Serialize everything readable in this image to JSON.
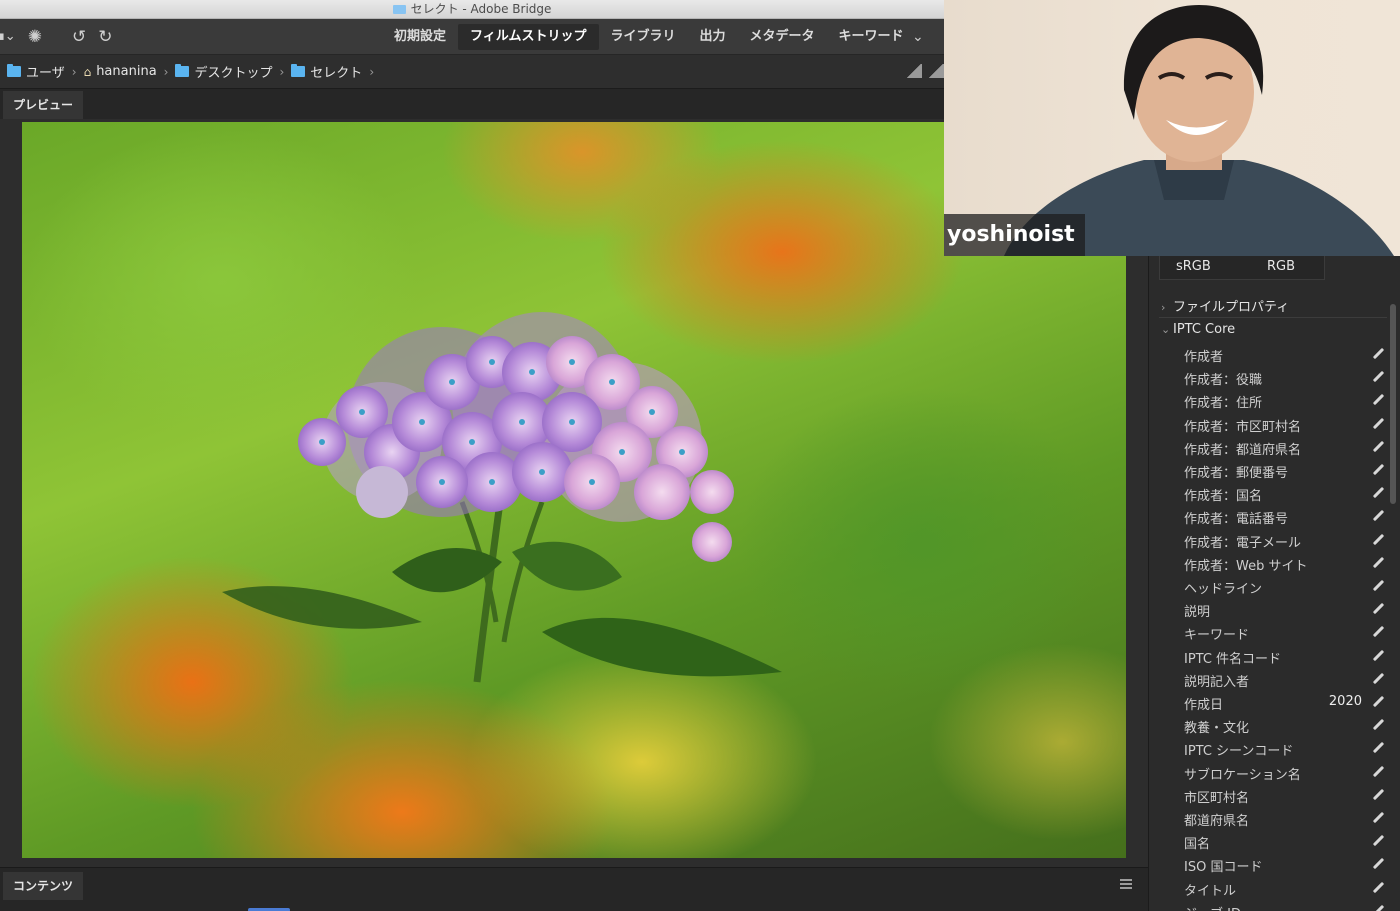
{
  "window": {
    "title": "セレクト - Adobe Bridge"
  },
  "toolbar": {
    "workspaces": [
      "初期設定",
      "フィルムストリップ",
      "ライブラリ",
      "出力",
      "メタデータ",
      "キーワード"
    ],
    "active_workspace": "フィルムストリップ"
  },
  "path": {
    "crumbs": [
      {
        "label": "ユーザ",
        "icon": "folder-icon"
      },
      {
        "label": "hananina",
        "icon": "home-icon"
      },
      {
        "label": "デスクトップ",
        "icon": "folder-icon"
      },
      {
        "label": "セレクト",
        "icon": "folder-icon"
      }
    ]
  },
  "preview": {
    "tab_label": "プレビュー"
  },
  "contents": {
    "tab_label": "コンテンツ"
  },
  "metadata": {
    "color_profile": "sRGB",
    "color_mode": "RGB",
    "file_properties": "ファイルプロパティ",
    "iptc_core": "IPTC Core",
    "fields": [
      {
        "label": "作成者",
        "value": ""
      },
      {
        "label": "作成者：役職",
        "value": ""
      },
      {
        "label": "作成者：住所",
        "value": ""
      },
      {
        "label": "作成者：市区町村名",
        "value": ""
      },
      {
        "label": "作成者：都道府県名",
        "value": ""
      },
      {
        "label": "作成者：郵便番号",
        "value": ""
      },
      {
        "label": "作成者：国名",
        "value": ""
      },
      {
        "label": "作成者：電話番号",
        "value": ""
      },
      {
        "label": "作成者：電子メール",
        "value": ""
      },
      {
        "label": "作成者：Web サイト",
        "value": ""
      },
      {
        "label": "ヘッドライン",
        "value": ""
      },
      {
        "label": "説明",
        "value": ""
      },
      {
        "label": "キーワード",
        "value": ""
      },
      {
        "label": "IPTC 件名コード",
        "value": ""
      },
      {
        "label": "説明記入者",
        "value": ""
      },
      {
        "label": "作成日",
        "value": "2020"
      },
      {
        "label": "教養・文化",
        "value": ""
      },
      {
        "label": "IPTC シーンコード",
        "value": ""
      },
      {
        "label": "サブロケーション名",
        "value": ""
      },
      {
        "label": "市区町村名",
        "value": ""
      },
      {
        "label": "都道府県名",
        "value": ""
      },
      {
        "label": "国名",
        "value": ""
      },
      {
        "label": "ISO 国コード",
        "value": ""
      },
      {
        "label": "タイトル",
        "value": ""
      },
      {
        "label": "ジョブ ID",
        "value": ""
      }
    ]
  },
  "webcam": {
    "participant_name": "yoshinoist"
  },
  "colors": {
    "accent": "#4a7bd4",
    "folder": "#5ab4f0",
    "panel_bg": "#2b2b2b"
  }
}
